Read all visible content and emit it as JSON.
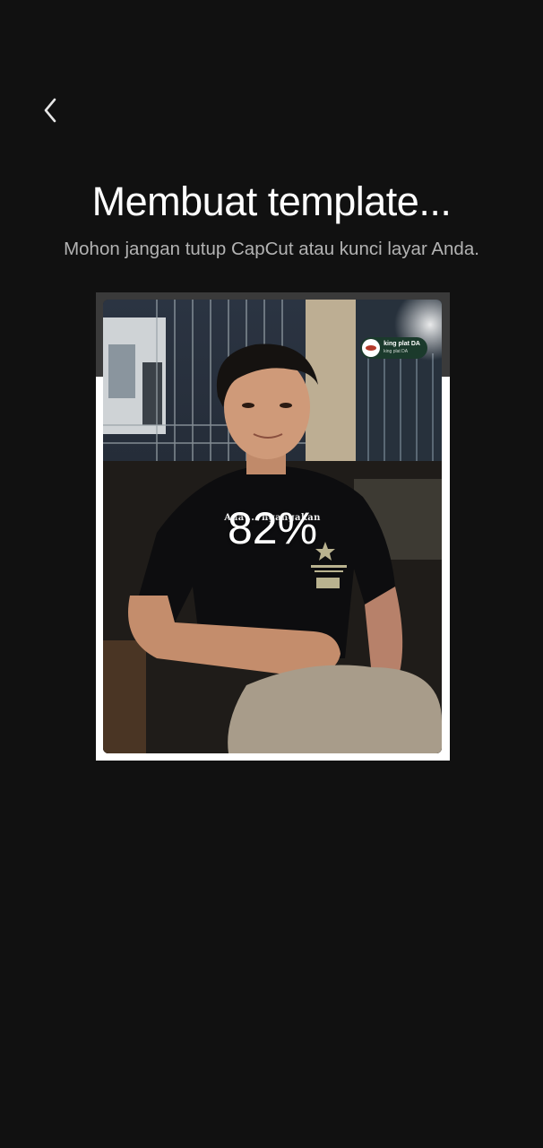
{
  "header": {
    "back_icon": "chevron-left-icon",
    "title": "Membuat template...",
    "subtitle": "Mohon jangan tutup CapCut atau kunci layar Anda."
  },
  "progress": {
    "percent_label": "82%",
    "value": 0.82
  },
  "preview": {
    "caption": "Ada ... ngangakan",
    "sticker_title": "king plat DA",
    "sticker_sub": "king plat DA"
  },
  "colors": {
    "background": "#111111",
    "title": "#ffffff",
    "subtitle": "#b3b3b3",
    "frame": "#ffffff",
    "frame_dim": "#3a3a3a"
  }
}
